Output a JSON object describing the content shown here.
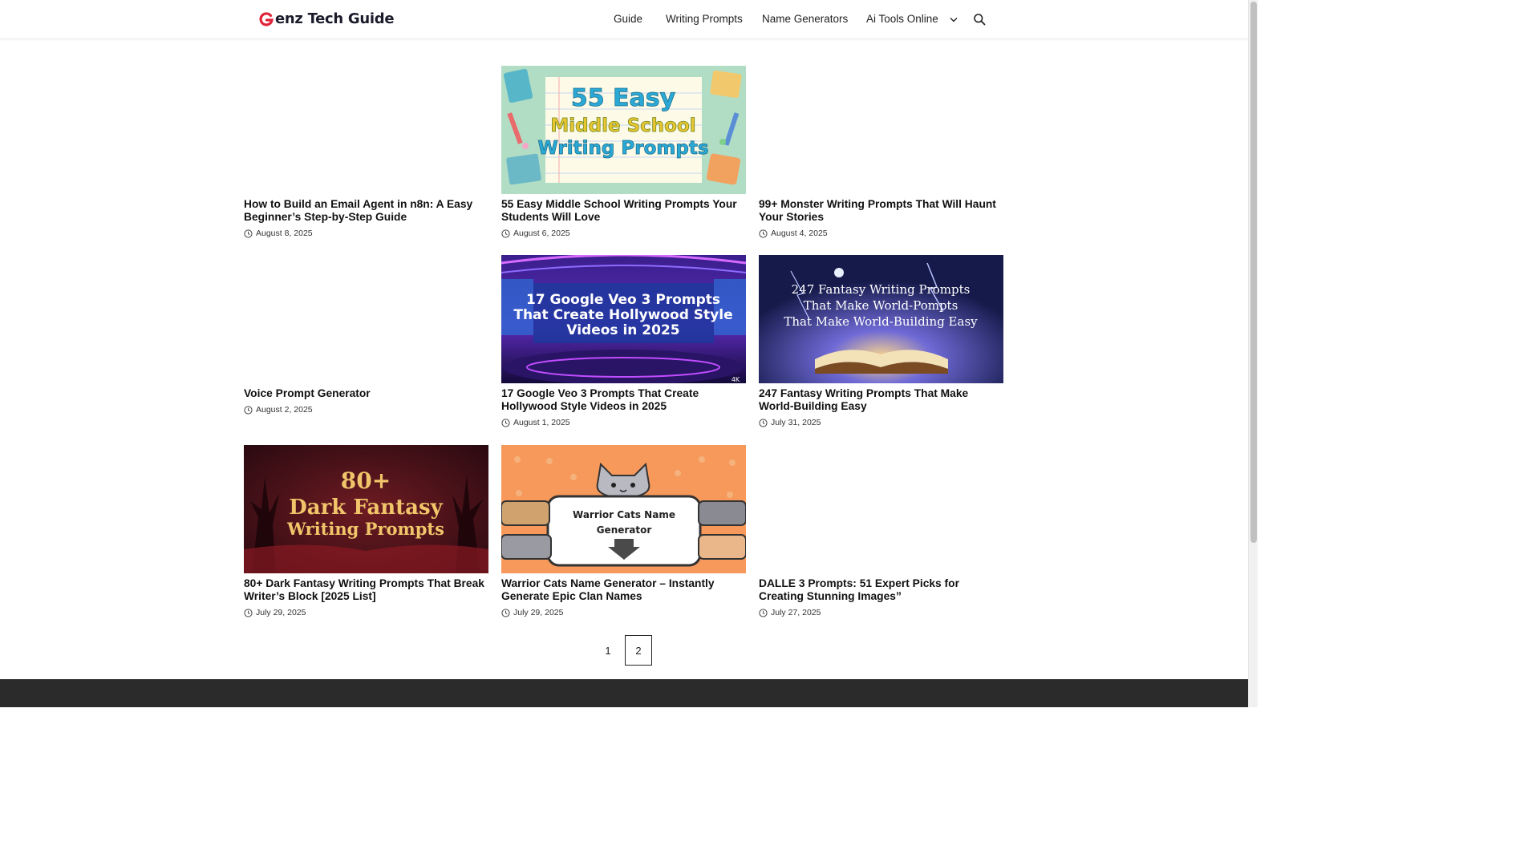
{
  "site": {
    "logo_text": "enz Tech Guide"
  },
  "nav": {
    "items": [
      "Guide",
      "Writing Prompts",
      "Name Generators",
      "Ai Tools Online"
    ]
  },
  "posts": [
    {
      "title": "How to Build an Email Agent in n8n: A Easy Beginner’s Step-by-Step Guide",
      "date": "August 8, 2025",
      "thumbnail": "none"
    },
    {
      "title": "55 Easy Middle School Writing Prompts Your Students Will Love",
      "date": "August 6, 2025",
      "thumbnail": "school",
      "thumb_text": [
        "55 Easy",
        "Middle School",
        "Writing Prompts"
      ]
    },
    {
      "title": "99+ Monster Writing Prompts That Will Haunt Your Stories",
      "date": "August 4, 2025",
      "thumbnail": "none"
    },
    {
      "title": "Voice Prompt Generator",
      "date": "August 2, 2025",
      "thumbnail": "none"
    },
    {
      "title": "17 Google Veo 3 Prompts That Create Hollywood Style Videos in 2025",
      "date": "August 1, 2025",
      "thumbnail": "studio",
      "thumb_text": [
        "17 Google Veo 3 Prompts",
        "That Create Hollywood Style",
        "Videos in 2025"
      ],
      "thumb_badge": "4K"
    },
    {
      "title": "247 Fantasy Writing Prompts That Make World-Building Easy",
      "date": "July 31, 2025",
      "thumbnail": "book",
      "thumb_text": [
        "247 Fantasy Writing Prompts",
        "That Make World-Pompts",
        "That Make World-Building Easy"
      ]
    },
    {
      "title": "80+ Dark Fantasy Writing Prompts That Break Writer’s Block [2025 List]",
      "date": "July 29, 2025",
      "thumbnail": "dark",
      "thumb_text": [
        "80+",
        "Dark Fantasy",
        "Writing Prompts"
      ]
    },
    {
      "title": "Warrior Cats Name Generator – Instantly Generate Epic Clan Names",
      "date": "July 29, 2025",
      "thumbnail": "cat",
      "thumb_text": [
        "Warrior Cats Name",
        "Generator"
      ]
    },
    {
      "title": "DALLE 3 Prompts: 51 Expert Picks for Creating Stunning Images”",
      "date": "July 27, 2025",
      "thumbnail": "none"
    }
  ],
  "pagination": {
    "pages": [
      "1",
      "2"
    ],
    "current": "2"
  },
  "colors": {
    "logo_accent": "#e0223a",
    "footer": "#2b2b2b",
    "text": "#111111"
  },
  "icons": {
    "search": "search-icon",
    "clock": "clock-icon",
    "dropdown": "chevron-down-icon"
  }
}
